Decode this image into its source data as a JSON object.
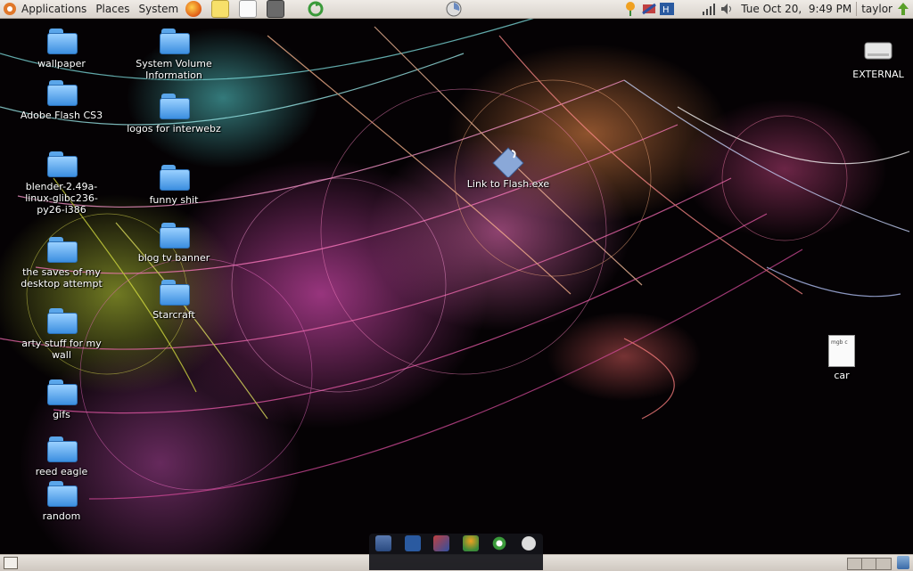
{
  "topbar": {
    "menus": [
      "Applications",
      "Places",
      "System"
    ],
    "clock": "Tue Oct 20,  9:49 PM",
    "user": "taylor",
    "icons": [
      "ubuntu-logo-icon",
      "firefox-icon",
      "notes-icon",
      "text-editor-icon",
      "calculator-icon",
      "refresh-icon",
      "chart-icon",
      "tulip-icon",
      "network-sync-icon",
      "mail-icon",
      "signal-icon",
      "volume-icon",
      "user-arrow-icon"
    ]
  },
  "desktop": {
    "left_icons": [
      {
        "label": "wallpaper"
      },
      {
        "label": "Adobe Flash CS3"
      },
      {
        "label": "blender-2.49a-linux-glibc236-py26-i386"
      },
      {
        "label": "the saves of my desktop attempt"
      },
      {
        "label": "arty stuff for my wall"
      },
      {
        "label": "gifs"
      },
      {
        "label": "reed eagle"
      },
      {
        "label": "random"
      }
    ],
    "second_col": [
      {
        "label": "System Volume Information"
      },
      {
        "label": "logos for interwebz"
      },
      {
        "label": "funny shit"
      },
      {
        "label": "blog tv banner"
      },
      {
        "label": "Starcraft"
      }
    ],
    "link": {
      "label": "Link to Flash.exe"
    },
    "drive": {
      "label": "EXTERNAL"
    },
    "file": {
      "label": "car",
      "badge": "mgb c"
    }
  },
  "colors": {
    "panel": "#e0dbd4",
    "folder": "#5aa6ea",
    "dock": "#141419"
  }
}
